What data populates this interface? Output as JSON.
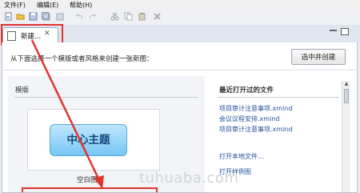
{
  "menu": {
    "file": "文件(F)",
    "edit": "编辑(E)",
    "help": "帮助(H)"
  },
  "tab": {
    "label": "新建...",
    "close_glyph": "✕"
  },
  "toolbar_icons": [
    "new-icon",
    "open-icon",
    "save-icon",
    "save-all-icon",
    "undo-icon",
    "redo-icon",
    "cut-icon",
    "copy-icon",
    "paste-icon",
    "delete-icon"
  ],
  "instruction": "从下面选择一个模版或者风格来创建一张新图：",
  "open_selected_button": "选中并创建",
  "templates": {
    "heading": "模版",
    "central_topic": "中心主题",
    "blank_label": "空白图"
  },
  "recent": {
    "heading": "最近打开过的文件",
    "files": [
      "项目审计注意事项.xmind",
      "会议议程安排.xmind",
      "项目审计注意事项.xmind"
    ],
    "open_local": "打开本地文件...",
    "open_sample": "打开样例图"
  },
  "watermark": "tuhuaba.com",
  "colors": {
    "annotation_red": "#e0342f",
    "link_blue": "#1f4f9a",
    "topic_blue": "#76c6f3"
  }
}
